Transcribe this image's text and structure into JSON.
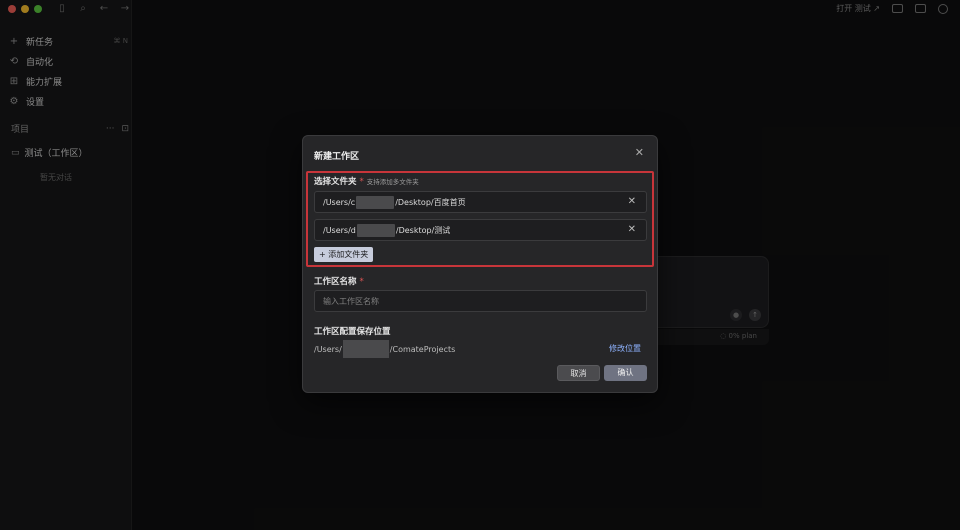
{
  "sidebar": {
    "menu": [
      {
        "icon": "plus-icon",
        "glyph": "+",
        "label": "新任务",
        "shortcut": "⌘ N"
      },
      {
        "icon": "history-icon",
        "glyph": "⟲",
        "label": "自动化",
        "shortcut": ""
      },
      {
        "icon": "extension-icon",
        "glyph": "⊞",
        "label": "能力扩展",
        "shortcut": ""
      },
      {
        "icon": "settings-icon",
        "glyph": "⚙",
        "label": "设置",
        "shortcut": ""
      }
    ],
    "projects_header": "项目",
    "project_name": "测试（工作区）",
    "empty_note": "暂无对话"
  },
  "topbar": {
    "open_label": "打开 测试 ↗"
  },
  "background_card": {
    "plan_label": "◌ 0% plan"
  },
  "dialog": {
    "title": "新建工作区",
    "folder_label": "选择文件夹",
    "required_mark": "*",
    "folder_hint": "支持添加多文件夹",
    "folders": [
      {
        "prefix": "/Users/c",
        "suffix": "/Desktop/百度首页"
      },
      {
        "prefix": "/Users/d",
        "suffix": "/Desktop/测试"
      }
    ],
    "add_folder_label": "+ 添加文件夹",
    "name_label": "工作区名称",
    "name_placeholder": "输入工作区名称",
    "location_label": "工作区配置保存位置",
    "location_prefix": "/Users/",
    "location_suffix": "/ComateProjects",
    "modify_link": "修改位置",
    "cancel_label": "取消",
    "confirm_label": "确认"
  }
}
